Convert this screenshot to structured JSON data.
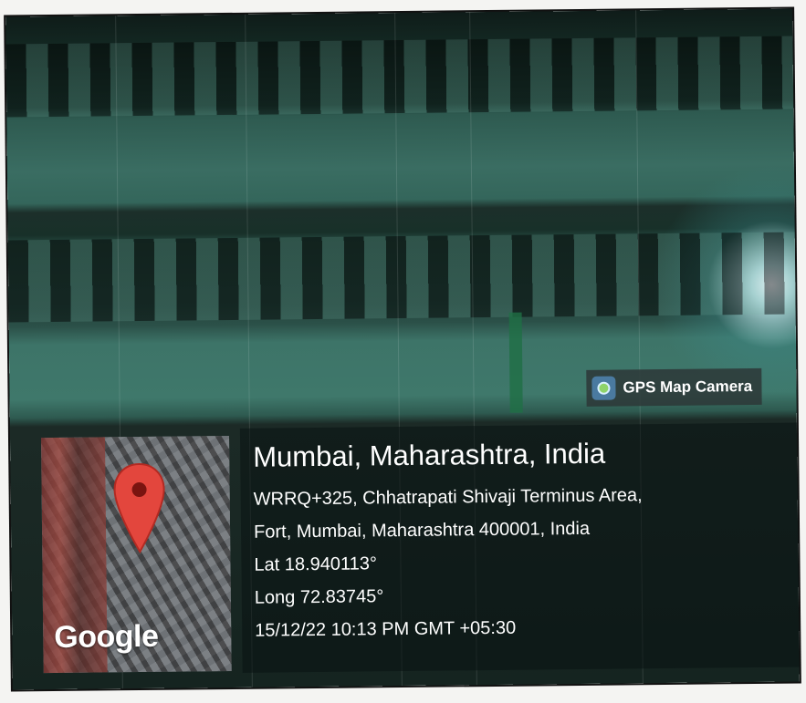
{
  "badge": {
    "label": "GPS Map Camera",
    "icon": "gps-map-camera-icon"
  },
  "map": {
    "brand": "Google",
    "pin_color": "#e3463d"
  },
  "location": {
    "city": "Mumbai, Maharashtra, India",
    "address_line_1": "WRRQ+325, Chhatrapati Shivaji Terminus Area,",
    "address_line_2": "Fort, Mumbai, Maharashtra 400001, India",
    "latitude": "Lat 18.940113°",
    "longitude": "Long 72.83745°",
    "datetime": "15/12/22 10:13 PM GMT +05:30"
  }
}
